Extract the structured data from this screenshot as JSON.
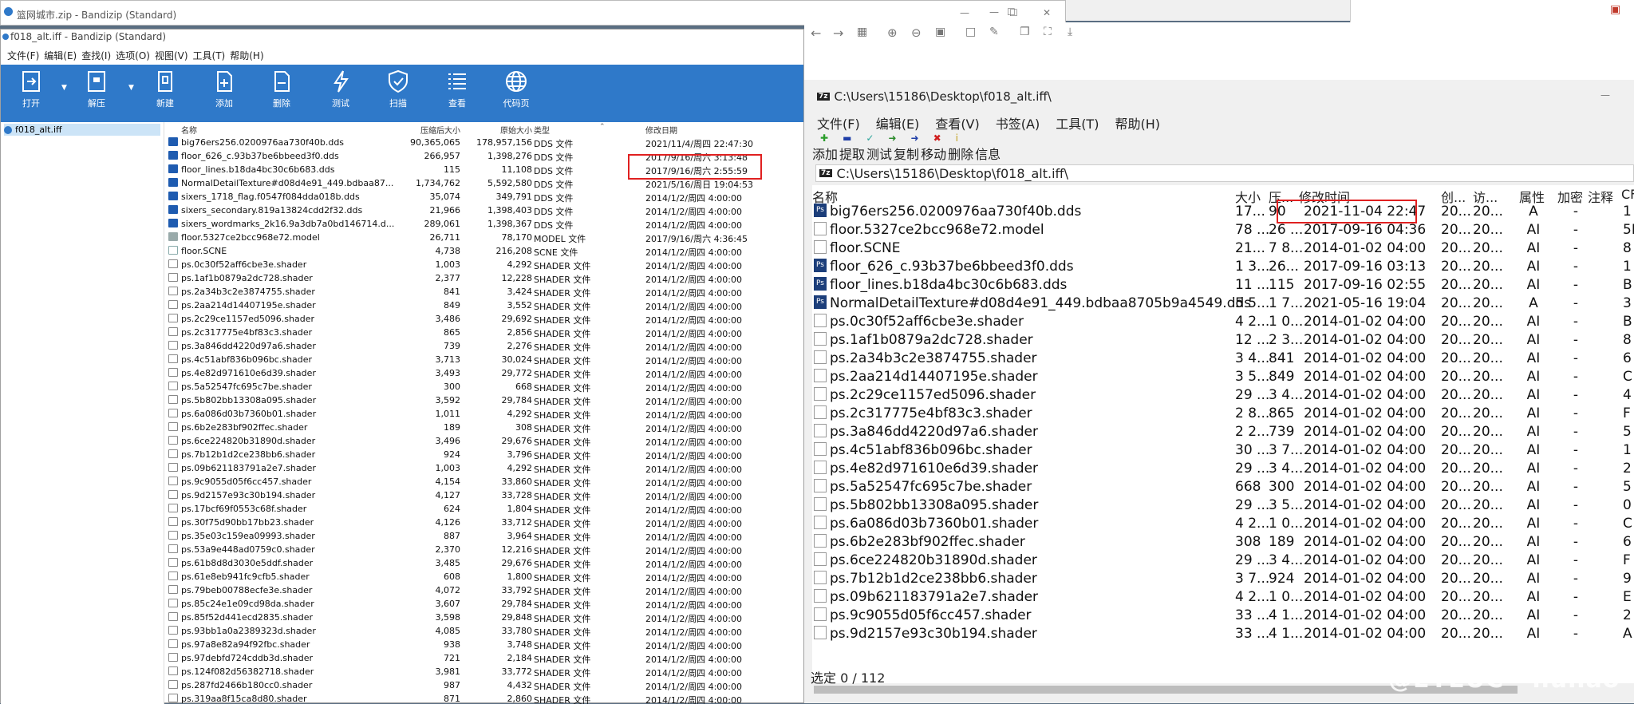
{
  "back_window": {
    "title": "篮网城市.zip - Bandizip (Standard)"
  },
  "bandizip": {
    "title": "f018_alt.iff - Bandizip (Standard)",
    "menu": [
      "文件(F)",
      "编辑(E)",
      "查找(I)",
      "选项(O)",
      "视图(V)",
      "工具(T)",
      "帮助(H)"
    ],
    "toolbar": [
      "打开",
      "解压",
      "新建",
      "添加",
      "删除",
      "测试",
      "扫描",
      "查看",
      "代码页"
    ],
    "tree_item": "f018_alt.iff",
    "columns": {
      "name": "名称",
      "compressed": "压缩后大小",
      "original": "原始大小",
      "type": "类型",
      "modified": "修改日期"
    },
    "rows": [
      {
        "name": "big76ers256.0200976aa730f40b.dds",
        "comp": "90,365,065",
        "orig": "178,957,156",
        "type": "DDS 文件",
        "date": "2021/11/4/周四 22:47:30",
        "icon": "dds"
      },
      {
        "name": "floor_626_c.93b37be6bbeed3f0.dds",
        "comp": "266,957",
        "orig": "1,398,276",
        "type": "DDS 文件",
        "date": "2017/9/16/周六 3:13:48",
        "icon": "dds"
      },
      {
        "name": "floor_lines.b18da4bc30c6b683.dds",
        "comp": "115",
        "orig": "11,108",
        "type": "DDS 文件",
        "date": "2017/9/16/周六 2:55:59",
        "icon": "dds"
      },
      {
        "name": "NormalDetailTexture#d08d4e91_449.bdbaa87...",
        "comp": "1,734,762",
        "orig": "5,592,580",
        "type": "DDS 文件",
        "date": "2021/5/16/周日 19:04:53",
        "icon": "dds"
      },
      {
        "name": "sixers_1718_flag.f0547f084dda018b.dds",
        "comp": "35,074",
        "orig": "349,791",
        "type": "DDS 文件",
        "date": "2014/1/2/周四 4:00:00",
        "icon": "dds"
      },
      {
        "name": "sixers_secondary.819a13824cdd2f32.dds",
        "comp": "21,966",
        "orig": "1,398,403",
        "type": "DDS 文件",
        "date": "2014/1/2/周四 4:00:00",
        "icon": "dds"
      },
      {
        "name": "sixers_wordmarks_2k16.9a3db7a0bd146714.d...",
        "comp": "289,061",
        "orig": "1,398,367",
        "type": "DDS 文件",
        "date": "2014/1/2/周四 4:00:00",
        "icon": "dds"
      },
      {
        "name": "floor.5327ce2bcc968e72.model",
        "comp": "26,711",
        "orig": "78,170",
        "type": "MODEL 文件",
        "date": "2017/9/16/周六 4:36:45",
        "icon": "model"
      },
      {
        "name": "floor.SCNE",
        "comp": "4,738",
        "orig": "216,208",
        "type": "SCNE 文件",
        "date": "2014/1/2/周四 4:00:00",
        "icon": "scne"
      },
      {
        "name": "ps.0c30f52aff6cbe3e.shader",
        "comp": "1,003",
        "orig": "4,292",
        "type": "SHADER 文件",
        "date": "2014/1/2/周四 4:00:00",
        "icon": "shader"
      },
      {
        "name": "ps.1af1b0879a2dc728.shader",
        "comp": "2,377",
        "orig": "12,228",
        "type": "SHADER 文件",
        "date": "2014/1/2/周四 4:00:00",
        "icon": "shader"
      },
      {
        "name": "ps.2a34b3c2e3874755.shader",
        "comp": "841",
        "orig": "3,424",
        "type": "SHADER 文件",
        "date": "2014/1/2/周四 4:00:00",
        "icon": "shader"
      },
      {
        "name": "ps.2aa214d14407195e.shader",
        "comp": "849",
        "orig": "3,552",
        "type": "SHADER 文件",
        "date": "2014/1/2/周四 4:00:00",
        "icon": "shader"
      },
      {
        "name": "ps.2c29ce1157ed5096.shader",
        "comp": "3,486",
        "orig": "29,692",
        "type": "SHADER 文件",
        "date": "2014/1/2/周四 4:00:00",
        "icon": "shader"
      },
      {
        "name": "ps.2c317775e4bf83c3.shader",
        "comp": "865",
        "orig": "2,856",
        "type": "SHADER 文件",
        "date": "2014/1/2/周四 4:00:00",
        "icon": "shader"
      },
      {
        "name": "ps.3a846dd4220d97a6.shader",
        "comp": "739",
        "orig": "2,276",
        "type": "SHADER 文件",
        "date": "2014/1/2/周四 4:00:00",
        "icon": "shader"
      },
      {
        "name": "ps.4c51abf836b096bc.shader",
        "comp": "3,713",
        "orig": "30,024",
        "type": "SHADER 文件",
        "date": "2014/1/2/周四 4:00:00",
        "icon": "shader"
      },
      {
        "name": "ps.4e82d971610e6d39.shader",
        "comp": "3,493",
        "orig": "29,772",
        "type": "SHADER 文件",
        "date": "2014/1/2/周四 4:00:00",
        "icon": "shader"
      },
      {
        "name": "ps.5a52547fc695c7be.shader",
        "comp": "300",
        "orig": "668",
        "type": "SHADER 文件",
        "date": "2014/1/2/周四 4:00:00",
        "icon": "shader"
      },
      {
        "name": "ps.5b802bb13308a095.shader",
        "comp": "3,592",
        "orig": "29,784",
        "type": "SHADER 文件",
        "date": "2014/1/2/周四 4:00:00",
        "icon": "shader"
      },
      {
        "name": "ps.6a086d03b7360b01.shader",
        "comp": "1,011",
        "orig": "4,292",
        "type": "SHADER 文件",
        "date": "2014/1/2/周四 4:00:00",
        "icon": "shader"
      },
      {
        "name": "ps.6b2e283bf902ffec.shader",
        "comp": "189",
        "orig": "308",
        "type": "SHADER 文件",
        "date": "2014/1/2/周四 4:00:00",
        "icon": "shader"
      },
      {
        "name": "ps.6ce224820b31890d.shader",
        "comp": "3,496",
        "orig": "29,676",
        "type": "SHADER 文件",
        "date": "2014/1/2/周四 4:00:00",
        "icon": "shader"
      },
      {
        "name": "ps.7b12b1d2ce238bb6.shader",
        "comp": "924",
        "orig": "3,796",
        "type": "SHADER 文件",
        "date": "2014/1/2/周四 4:00:00",
        "icon": "shader"
      },
      {
        "name": "ps.09b621183791a2e7.shader",
        "comp": "1,003",
        "orig": "4,292",
        "type": "SHADER 文件",
        "date": "2014/1/2/周四 4:00:00",
        "icon": "shader"
      },
      {
        "name": "ps.9c9055d05f6cc457.shader",
        "comp": "4,154",
        "orig": "33,860",
        "type": "SHADER 文件",
        "date": "2014/1/2/周四 4:00:00",
        "icon": "shader"
      },
      {
        "name": "ps.9d2157e93c30b194.shader",
        "comp": "4,127",
        "orig": "33,728",
        "type": "SHADER 文件",
        "date": "2014/1/2/周四 4:00:00",
        "icon": "shader"
      },
      {
        "name": "ps.17bcf69f0553c68f.shader",
        "comp": "624",
        "orig": "1,804",
        "type": "SHADER 文件",
        "date": "2014/1/2/周四 4:00:00",
        "icon": "shader"
      },
      {
        "name": "ps.30f75d90bb17bb23.shader",
        "comp": "4,126",
        "orig": "33,712",
        "type": "SHADER 文件",
        "date": "2014/1/2/周四 4:00:00",
        "icon": "shader"
      },
      {
        "name": "ps.35e03c159ea09993.shader",
        "comp": "887",
        "orig": "3,964",
        "type": "SHADER 文件",
        "date": "2014/1/2/周四 4:00:00",
        "icon": "shader"
      },
      {
        "name": "ps.53a9e448ad0759c0.shader",
        "comp": "2,370",
        "orig": "12,216",
        "type": "SHADER 文件",
        "date": "2014/1/2/周四 4:00:00",
        "icon": "shader"
      },
      {
        "name": "ps.61b8d8d3030e5ddf.shader",
        "comp": "3,485",
        "orig": "29,676",
        "type": "SHADER 文件",
        "date": "2014/1/2/周四 4:00:00",
        "icon": "shader"
      },
      {
        "name": "ps.61e8eb941fc9cfb5.shader",
        "comp": "608",
        "orig": "1,800",
        "type": "SHADER 文件",
        "date": "2014/1/2/周四 4:00:00",
        "icon": "shader"
      },
      {
        "name": "ps.79beb00788ecfe3e.shader",
        "comp": "4,072",
        "orig": "33,792",
        "type": "SHADER 文件",
        "date": "2014/1/2/周四 4:00:00",
        "icon": "shader"
      },
      {
        "name": "ps.85c24e1e09cd98da.shader",
        "comp": "3,607",
        "orig": "29,784",
        "type": "SHADER 文件",
        "date": "2014/1/2/周四 4:00:00",
        "icon": "shader"
      },
      {
        "name": "ps.85f52d441ecd2835.shader",
        "comp": "3,598",
        "orig": "29,848",
        "type": "SHADER 文件",
        "date": "2014/1/2/周四 4:00:00",
        "icon": "shader"
      },
      {
        "name": "ps.93bb1a0a2389323d.shader",
        "comp": "4,085",
        "orig": "33,780",
        "type": "SHADER 文件",
        "date": "2014/1/2/周四 4:00:00",
        "icon": "shader"
      },
      {
        "name": "ps.97a8e82a94f92fbc.shader",
        "comp": "938",
        "orig": "3,748",
        "type": "SHADER 文件",
        "date": "2014/1/2/周四 4:00:00",
        "icon": "shader"
      },
      {
        "name": "ps.97debfd724cddb3d.shader",
        "comp": "721",
        "orig": "2,184",
        "type": "SHADER 文件",
        "date": "2014/1/2/周四 4:00:00",
        "icon": "shader"
      },
      {
        "name": "ps.124f082d56382718.shader",
        "comp": "3,981",
        "orig": "33,772",
        "type": "SHADER 文件",
        "date": "2014/1/2/周四 4:00:00",
        "icon": "shader"
      },
      {
        "name": "ps.287fd2466b180cc0.shader",
        "comp": "987",
        "orig": "4,432",
        "type": "SHADER 文件",
        "date": "2014/1/2/周四 4:00:00",
        "icon": "shader"
      },
      {
        "name": "ps.319aa8f15ca8d80.shader",
        "comp": "871",
        "orig": "2,860",
        "type": "SHADER 文件",
        "date": "2014/1/2/周四 4:00:00",
        "icon": "shader"
      }
    ]
  },
  "sevenzip": {
    "title": "C:\\Users\\15186\\Desktop\\f018_alt.iff\\",
    "menu": [
      "文件(F)",
      "编辑(E)",
      "查看(V)",
      "书签(A)",
      "工具(T)",
      "帮助(H)"
    ],
    "toolbar": [
      "添加",
      "提取",
      "测试",
      "复制",
      "移动",
      "删除",
      "信息"
    ],
    "address": "C:\\Users\\15186\\Desktop\\f018_alt.iff\\",
    "columns": {
      "name": "名称",
      "size": "大小",
      "psize": "压...",
      "mtime": "修改时间",
      "ctime": "创...",
      "atime": "访...",
      "attr": "属性",
      "enc": "加密",
      "cmt": "注释",
      "crc": "CF"
    },
    "rows": [
      {
        "name": "big76ers256.0200976aa730f40b.dds",
        "size": "17...",
        "psize": "90",
        "mtime": "2021-11-04 22:47",
        "ctime": "20...",
        "atime": "20...",
        "attr": "A",
        "enc": "-",
        "crc": "1",
        "icon": "ps"
      },
      {
        "name": "floor.5327ce2bcc968e72.model",
        "size": "78 ...",
        "psize": "26 ...",
        "mtime": "2017-09-16 04:36",
        "ctime": "20...",
        "atime": "20...",
        "attr": "AI",
        "enc": "-",
        "crc": "5F",
        "icon": "file"
      },
      {
        "name": "floor.SCNE",
        "size": "21...",
        "psize": "7 8...",
        "mtime": "2014-01-02 04:00",
        "ctime": "20...",
        "atime": "20...",
        "attr": "AI",
        "enc": "-",
        "crc": "8",
        "icon": "file"
      },
      {
        "name": "floor_626_c.93b37be6bbeed3f0.dds",
        "size": "1 3...",
        "psize": "26...",
        "mtime": "2017-09-16 03:13",
        "ctime": "20...",
        "atime": "20...",
        "attr": "AI",
        "enc": "-",
        "crc": "1",
        "icon": "ps"
      },
      {
        "name": "floor_lines.b18da4bc30c6b683.dds",
        "size": "11 ...",
        "psize": "115",
        "mtime": "2017-09-16 02:55",
        "ctime": "20...",
        "atime": "20...",
        "attr": "AI",
        "enc": "-",
        "crc": "B",
        "icon": "ps"
      },
      {
        "name": "NormalDetailTexture#d08d4e91_449.bdbaa8705b9a4549.dds",
        "size": "5 5...",
        "psize": "1 7...",
        "mtime": "2021-05-16 19:04",
        "ctime": "20...",
        "atime": "20...",
        "attr": "A",
        "enc": "-",
        "crc": "3",
        "icon": "ps"
      },
      {
        "name": "ps.0c30f52aff6cbe3e.shader",
        "size": "4 2...",
        "psize": "1 0...",
        "mtime": "2014-01-02 04:00",
        "ctime": "20...",
        "atime": "20...",
        "attr": "AI",
        "enc": "-",
        "crc": "B",
        "icon": "file"
      },
      {
        "name": "ps.1af1b0879a2dc728.shader",
        "size": "12 ...",
        "psize": "2 3...",
        "mtime": "2014-01-02 04:00",
        "ctime": "20...",
        "atime": "20...",
        "attr": "AI",
        "enc": "-",
        "crc": "8",
        "icon": "file"
      },
      {
        "name": "ps.2a34b3c2e3874755.shader",
        "size": "3 4...",
        "psize": "841",
        "mtime": "2014-01-02 04:00",
        "ctime": "20...",
        "atime": "20...",
        "attr": "AI",
        "enc": "-",
        "crc": "6",
        "icon": "file"
      },
      {
        "name": "ps.2aa214d14407195e.shader",
        "size": "3 5...",
        "psize": "849",
        "mtime": "2014-01-02 04:00",
        "ctime": "20...",
        "atime": "20...",
        "attr": "AI",
        "enc": "-",
        "crc": "C",
        "icon": "file"
      },
      {
        "name": "ps.2c29ce1157ed5096.shader",
        "size": "29 ...",
        "psize": "3 4...",
        "mtime": "2014-01-02 04:00",
        "ctime": "20...",
        "atime": "20...",
        "attr": "AI",
        "enc": "-",
        "crc": "4",
        "icon": "file"
      },
      {
        "name": "ps.2c317775e4bf83c3.shader",
        "size": "2 8...",
        "psize": "865",
        "mtime": "2014-01-02 04:00",
        "ctime": "20...",
        "atime": "20...",
        "attr": "AI",
        "enc": "-",
        "crc": "F",
        "icon": "file"
      },
      {
        "name": "ps.3a846dd4220d97a6.shader",
        "size": "2 2...",
        "psize": "739",
        "mtime": "2014-01-02 04:00",
        "ctime": "20...",
        "atime": "20...",
        "attr": "AI",
        "enc": "-",
        "crc": "5",
        "icon": "file"
      },
      {
        "name": "ps.4c51abf836b096bc.shader",
        "size": "30 ...",
        "psize": "3 7...",
        "mtime": "2014-01-02 04:00",
        "ctime": "20...",
        "atime": "20...",
        "attr": "AI",
        "enc": "-",
        "crc": "1",
        "icon": "file"
      },
      {
        "name": "ps.4e82d971610e6d39.shader",
        "size": "29 ...",
        "psize": "3 4...",
        "mtime": "2014-01-02 04:00",
        "ctime": "20...",
        "atime": "20...",
        "attr": "AI",
        "enc": "-",
        "crc": "2",
        "icon": "file"
      },
      {
        "name": "ps.5a52547fc695c7be.shader",
        "size": "668",
        "psize": "300",
        "mtime": "2014-01-02 04:00",
        "ctime": "20...",
        "atime": "20...",
        "attr": "AI",
        "enc": "-",
        "crc": "5",
        "icon": "file"
      },
      {
        "name": "ps.5b802bb13308a095.shader",
        "size": "29 ...",
        "psize": "3 5...",
        "mtime": "2014-01-02 04:00",
        "ctime": "20...",
        "atime": "20...",
        "attr": "AI",
        "enc": "-",
        "crc": "0",
        "icon": "file"
      },
      {
        "name": "ps.6a086d03b7360b01.shader",
        "size": "4 2...",
        "psize": "1 0...",
        "mtime": "2014-01-02 04:00",
        "ctime": "20...",
        "atime": "20...",
        "attr": "AI",
        "enc": "-",
        "crc": "C",
        "icon": "file"
      },
      {
        "name": "ps.6b2e283bf902ffec.shader",
        "size": "308",
        "psize": "189",
        "mtime": "2014-01-02 04:00",
        "ctime": "20...",
        "atime": "20...",
        "attr": "AI",
        "enc": "-",
        "crc": "6",
        "icon": "file"
      },
      {
        "name": "ps.6ce224820b31890d.shader",
        "size": "29 ...",
        "psize": "3 4...",
        "mtime": "2014-01-02 04:00",
        "ctime": "20...",
        "atime": "20...",
        "attr": "AI",
        "enc": "-",
        "crc": "F",
        "icon": "file"
      },
      {
        "name": "ps.7b12b1d2ce238bb6.shader",
        "size": "3 7...",
        "psize": "924",
        "mtime": "2014-01-02 04:00",
        "ctime": "20...",
        "atime": "20...",
        "attr": "AI",
        "enc": "-",
        "crc": "9",
        "icon": "file"
      },
      {
        "name": "ps.09b621183791a2e7.shader",
        "size": "4 2...",
        "psize": "1 0...",
        "mtime": "2014-01-02 04:00",
        "ctime": "20...",
        "atime": "20...",
        "attr": "AI",
        "enc": "-",
        "crc": "E",
        "icon": "file"
      },
      {
        "name": "ps.9c9055d05f6cc457.shader",
        "size": "33 ...",
        "psize": "4 1...",
        "mtime": "2014-01-02 04:00",
        "ctime": "20...",
        "atime": "20...",
        "attr": "AI",
        "enc": "-",
        "crc": "2",
        "icon": "file"
      },
      {
        "name": "ps.9d2157e93c30b194.shader",
        "size": "33 ...",
        "psize": "4 1...",
        "mtime": "2014-01-02 04:00",
        "ctime": "20...",
        "atime": "20...",
        "attr": "AI",
        "enc": "-",
        "crc": "A",
        "icon": "file"
      }
    ],
    "status": "选定 0 / 112",
    "watermark": "@EYEUC · huilao"
  }
}
